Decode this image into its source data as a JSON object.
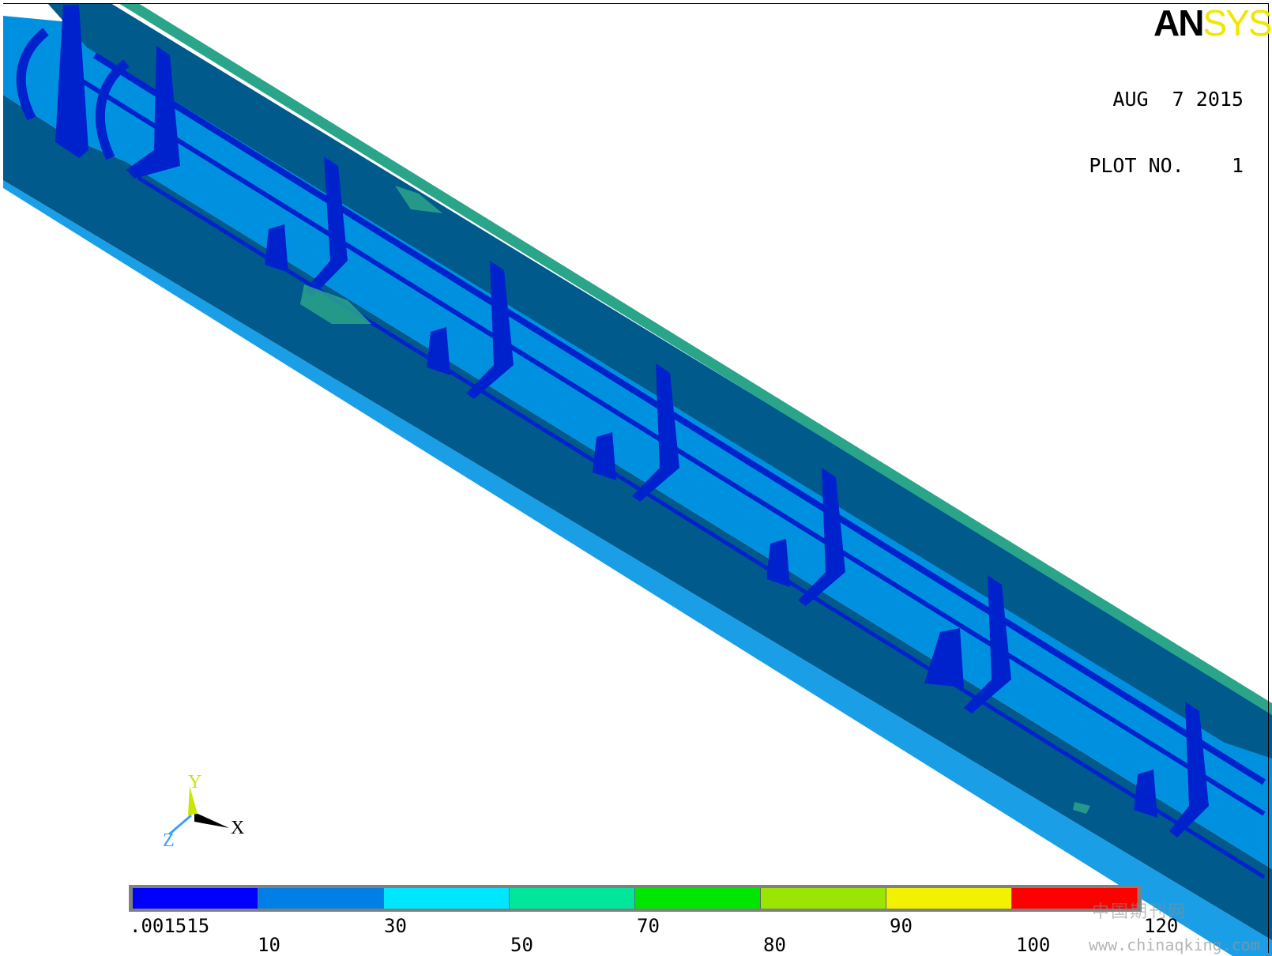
{
  "logo": {
    "part1": "AN",
    "part2": "SYS"
  },
  "plot_info": {
    "date": "AUG  7 2015",
    "plot_no": "PLOT NO.    1"
  },
  "triad": {
    "x_label": "X",
    "y_label": "Y",
    "z_label": "Z",
    "x_color": "#000000",
    "y_color": "#c8e600",
    "z_color": "#3ba0ff"
  },
  "legend": {
    "colors": [
      "#0000ff",
      "#0080e6",
      "#00e6ff",
      "#00e69a",
      "#00e600",
      "#9ae600",
      "#f2f200",
      "#ff0000"
    ],
    "labels": [
      ".001515",
      "10",
      "30",
      "50",
      "70",
      "80",
      "90",
      "100",
      "120"
    ]
  },
  "model_colors": {
    "web_dark": "#005a8c",
    "surface_mid": "#0090e0",
    "edge_light": "#1a9fe6",
    "stiffener": "#0022cc",
    "green_patch": "#2aa58a"
  },
  "watermark": {
    "cn": "中国期刊网",
    "url": "www.chinaqking.com"
  }
}
